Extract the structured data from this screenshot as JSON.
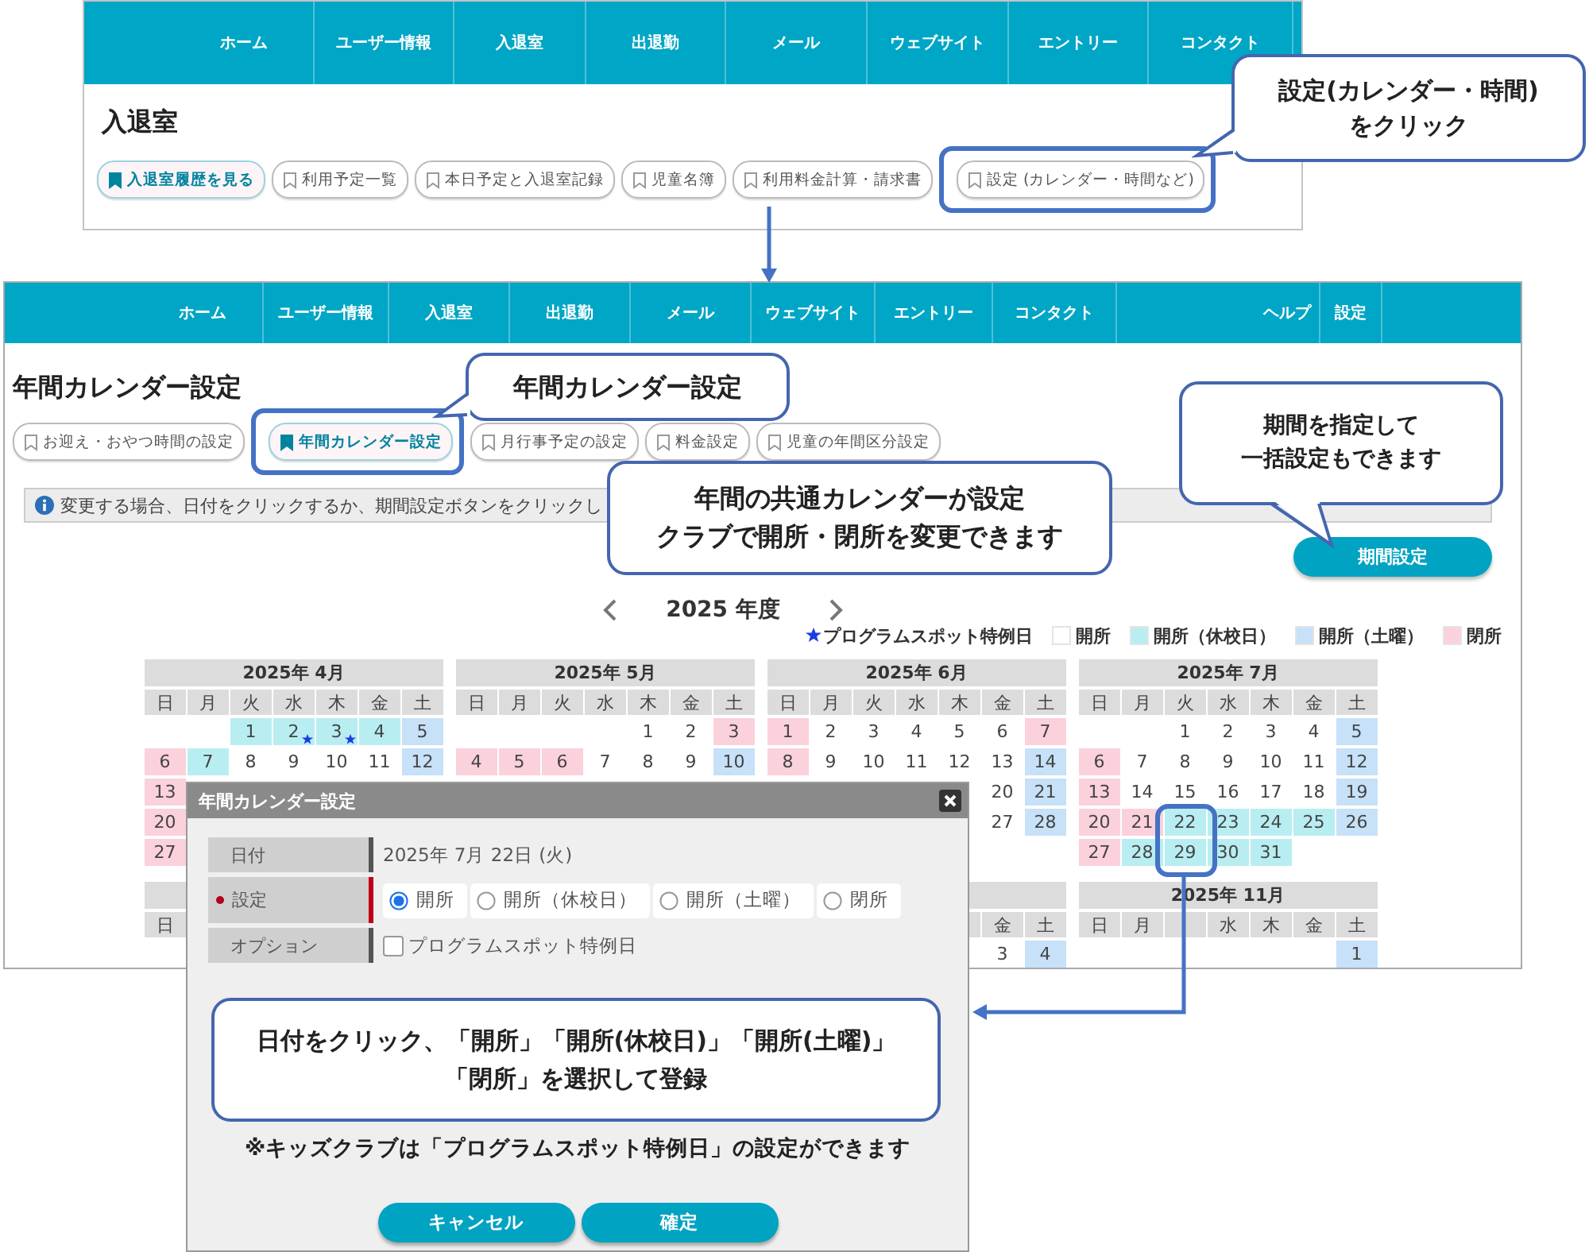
{
  "top_screen": {
    "nav": [
      "ホーム",
      "ユーザー情報",
      "入退室",
      "出退勤",
      "メール",
      "ウェブサイト",
      "エントリー",
      "コンタクト"
    ],
    "title": "入退室",
    "tabs": [
      {
        "label": "入退室履歴を見る",
        "selected": true
      },
      {
        "label": "利用予定一覧",
        "selected": false
      },
      {
        "label": "本日予定と入退室記録",
        "selected": false
      },
      {
        "label": "児童名簿",
        "selected": false
      },
      {
        "label": "利用料金計算・請求書",
        "selected": false
      },
      {
        "label": "設定 (カレンダー・時間など)",
        "selected": false
      }
    ]
  },
  "screen": {
    "nav": [
      "ホーム",
      "ユーザー情報",
      "入退室",
      "出退勤",
      "メール",
      "ウェブサイト",
      "エントリー",
      "コンタクト"
    ],
    "nav_right": [
      "ヘルプ",
      "設定"
    ],
    "title": "年間カレンダー設定",
    "tabs": [
      {
        "label": "お迎え・おやつ時間の設定",
        "selected": false
      },
      {
        "label": "年間カレンダー設定",
        "selected": true
      },
      {
        "label": "月行事予定の設定",
        "selected": false
      },
      {
        "label": "料金設定",
        "selected": false
      },
      {
        "label": "児童の年間区分設定",
        "selected": false
      }
    ],
    "info": "変更する場合、日付をクリックするか、期間設定ボタンをクリックし",
    "period_button": "期間設定",
    "year": "2025 年度",
    "legend": {
      "star_label": "プログラムスポット特例日",
      "items": [
        {
          "label": "開所",
          "color": "#ffffff"
        },
        {
          "label": "開所（休校日）",
          "color": "#b8eef1"
        },
        {
          "label": "開所（土曜）",
          "color": "#c6e1f8"
        },
        {
          "label": "閉所",
          "color": "#fbd1dc"
        }
      ]
    },
    "calendar": {
      "months": [
        {
          "kind": "month",
          "title": "2025年 4月",
          "weekdays": [
            {
              "kind": "label",
              "label": "日"
            },
            {
              "kind": "label",
              "label": "月"
            },
            {
              "kind": "label",
              "label": "火"
            },
            {
              "kind": "label",
              "label": "水"
            },
            {
              "kind": "label",
              "label": "木"
            },
            {
              "kind": "label",
              "label": "金"
            },
            {
              "kind": "label",
              "label": "土"
            }
          ],
          "weeks": [
            [
              {
                "kind": "blank"
              },
              {
                "kind": "blank"
              },
              {
                "kind": "date",
                "day": "1",
                "color": "#b8eef1",
                "star": false
              },
              {
                "kind": "date",
                "day": "2",
                "color": "#b8eef1",
                "star": true
              },
              {
                "kind": "date",
                "day": "3",
                "color": "#b8eef1",
                "star": true
              },
              {
                "kind": "date",
                "day": "4",
                "color": "#b8eef1",
                "star": false
              },
              {
                "kind": "date",
                "day": "5",
                "color": "#c6e1f8",
                "star": false
              }
            ],
            [
              {
                "kind": "date",
                "day": "6",
                "color": "#fbd1dc",
                "star": false
              },
              {
                "kind": "date",
                "day": "7",
                "color": "#b8eef1",
                "star": false
              },
              {
                "kind": "date",
                "day": "8",
                "color": "#ffffff",
                "star": false
              },
              {
                "kind": "date",
                "day": "9",
                "color": "#ffffff",
                "star": false
              },
              {
                "kind": "date",
                "day": "10",
                "color": "#ffffff",
                "star": false
              },
              {
                "kind": "date",
                "day": "11",
                "color": "#ffffff",
                "star": false
              },
              {
                "kind": "date",
                "day": "12",
                "color": "#c6e1f8",
                "star": false
              }
            ],
            [
              {
                "kind": "date",
                "day": "13",
                "color": "#fbd1dc",
                "star": false
              }
            ],
            [
              {
                "kind": "date",
                "day": "20",
                "color": "#fbd1dc",
                "star": false
              }
            ],
            [
              {
                "kind": "date",
                "day": "27",
                "color": "#fbd1dc",
                "star": false
              }
            ]
          ]
        },
        {
          "kind": "month",
          "title": "2025年 5月",
          "weekdays": [
            {
              "kind": "label",
              "label": "日"
            },
            {
              "kind": "label",
              "label": "月"
            },
            {
              "kind": "label",
              "label": "火"
            },
            {
              "kind": "label",
              "label": "水"
            },
            {
              "kind": "label",
              "label": "木"
            },
            {
              "kind": "label",
              "label": "金"
            },
            {
              "kind": "label",
              "label": "土"
            }
          ],
          "weeks": [
            [
              {
                "kind": "blank"
              },
              {
                "kind": "blank"
              },
              {
                "kind": "blank"
              },
              {
                "kind": "blank"
              },
              {
                "kind": "date",
                "day": "1",
                "color": "#ffffff",
                "star": false
              },
              {
                "kind": "date",
                "day": "2",
                "color": "#ffffff",
                "star": false
              },
              {
                "kind": "date",
                "day": "3",
                "color": "#fbd1dc",
                "star": false
              }
            ],
            [
              {
                "kind": "date",
                "day": "4",
                "color": "#fbd1dc",
                "star": false
              },
              {
                "kind": "date",
                "day": "5",
                "color": "#fbd1dc",
                "star": false
              },
              {
                "kind": "date",
                "day": "6",
                "color": "#fbd1dc",
                "star": false
              },
              {
                "kind": "date",
                "day": "7",
                "color": "#ffffff",
                "star": false
              },
              {
                "kind": "date",
                "day": "8",
                "color": "#ffffff",
                "star": false
              },
              {
                "kind": "date",
                "day": "9",
                "color": "#ffffff",
                "star": false
              },
              {
                "kind": "date",
                "day": "10",
                "color": "#c6e1f8",
                "star": false
              }
            ]
          ]
        },
        {
          "kind": "month",
          "title": "2025年 6月",
          "weekdays": [
            {
              "kind": "label",
              "label": "日"
            },
            {
              "kind": "label",
              "label": "月"
            },
            {
              "kind": "label",
              "label": "火"
            },
            {
              "kind": "label",
              "label": "水"
            },
            {
              "kind": "label",
              "label": "木"
            },
            {
              "kind": "label",
              "label": "金"
            },
            {
              "kind": "label",
              "label": "土"
            }
          ],
          "weeks": [
            [
              {
                "kind": "date",
                "day": "1",
                "color": "#fbd1dc",
                "star": false
              },
              {
                "kind": "date",
                "day": "2",
                "color": "#ffffff",
                "star": false
              },
              {
                "kind": "date",
                "day": "3",
                "color": "#ffffff",
                "star": false
              },
              {
                "kind": "date",
                "day": "4",
                "color": "#ffffff",
                "star": false
              },
              {
                "kind": "date",
                "day": "5",
                "color": "#ffffff",
                "star": false
              },
              {
                "kind": "date",
                "day": "6",
                "color": "#ffffff",
                "star": false
              },
              {
                "kind": "date",
                "day": "7",
                "color": "#fbd1dc",
                "star": false
              }
            ],
            [
              {
                "kind": "date",
                "day": "8",
                "color": "#fbd1dc",
                "star": false
              },
              {
                "kind": "date",
                "day": "9",
                "color": "#ffffff",
                "star": false
              },
              {
                "kind": "date",
                "day": "10",
                "color": "#ffffff",
                "star": false
              },
              {
                "kind": "date",
                "day": "11",
                "color": "#ffffff",
                "star": false
              },
              {
                "kind": "date",
                "day": "12",
                "color": "#ffffff",
                "star": false
              },
              {
                "kind": "date",
                "day": "13",
                "color": "#ffffff",
                "star": false
              },
              {
                "kind": "date",
                "day": "14",
                "color": "#c6e1f8",
                "star": false
              }
            ],
            [
              {
                "kind": "blank"
              },
              {
                "kind": "blank"
              },
              {
                "kind": "blank"
              },
              {
                "kind": "blank"
              },
              {
                "kind": "blank"
              },
              {
                "kind": "date",
                "day": "20",
                "color": "#ffffff",
                "star": false
              },
              {
                "kind": "date",
                "day": "21",
                "color": "#c6e1f8",
                "star": false
              }
            ],
            [
              {
                "kind": "blank"
              },
              {
                "kind": "blank"
              },
              {
                "kind": "blank"
              },
              {
                "kind": "blank"
              },
              {
                "kind": "blank"
              },
              {
                "kind": "date",
                "day": "27",
                "color": "#ffffff",
                "star": false
              },
              {
                "kind": "date",
                "day": "28",
                "color": "#c6e1f8",
                "star": false
              }
            ]
          ]
        },
        {
          "kind": "month",
          "title": "2025年 7月",
          "weekdays": [
            {
              "kind": "label",
              "label": "日"
            },
            {
              "kind": "label",
              "label": "月"
            },
            {
              "kind": "label",
              "label": "火"
            },
            {
              "kind": "label",
              "label": "水"
            },
            {
              "kind": "label",
              "label": "木"
            },
            {
              "kind": "label",
              "label": "金"
            },
            {
              "kind": "label",
              "label": "土"
            }
          ],
          "weeks": [
            [
              {
                "kind": "blank"
              },
              {
                "kind": "blank"
              },
              {
                "kind": "date",
                "day": "1",
                "color": "#ffffff",
                "star": false
              },
              {
                "kind": "date",
                "day": "2",
                "color": "#ffffff",
                "star": false
              },
              {
                "kind": "date",
                "day": "3",
                "color": "#ffffff",
                "star": false
              },
              {
                "kind": "date",
                "day": "4",
                "color": "#ffffff",
                "star": false
              },
              {
                "kind": "date",
                "day": "5",
                "color": "#c6e1f8",
                "star": false
              }
            ],
            [
              {
                "kind": "date",
                "day": "6",
                "color": "#fbd1dc",
                "star": false
              },
              {
                "kind": "date",
                "day": "7",
                "color": "#ffffff",
                "star": false
              },
              {
                "kind": "date",
                "day": "8",
                "color": "#ffffff",
                "star": false
              },
              {
                "kind": "date",
                "day": "9",
                "color": "#ffffff",
                "star": false
              },
              {
                "kind": "date",
                "day": "10",
                "color": "#ffffff",
                "star": false
              },
              {
                "kind": "date",
                "day": "11",
                "color": "#ffffff",
                "star": false
              },
              {
                "kind": "date",
                "day": "12",
                "color": "#c6e1f8",
                "star": false
              }
            ],
            [
              {
                "kind": "date",
                "day": "13",
                "color": "#fbd1dc",
                "star": false
              },
              {
                "kind": "date",
                "day": "14",
                "color": "#ffffff",
                "star": false
              },
              {
                "kind": "date",
                "day": "15",
                "color": "#ffffff",
                "star": false
              },
              {
                "kind": "date",
                "day": "16",
                "color": "#ffffff",
                "star": false
              },
              {
                "kind": "date",
                "day": "17",
                "color": "#ffffff",
                "star": false
              },
              {
                "kind": "date",
                "day": "18",
                "color": "#ffffff",
                "star": false
              },
              {
                "kind": "date",
                "day": "19",
                "color": "#c6e1f8",
                "star": false
              }
            ],
            [
              {
                "kind": "date",
                "day": "20",
                "color": "#fbd1dc",
                "star": false
              },
              {
                "kind": "date",
                "day": "21",
                "color": "#fbd1dc",
                "star": false
              },
              {
                "kind": "date",
                "day": "22",
                "color": "#b8eef1",
                "star": false
              },
              {
                "kind": "date",
                "day": "23",
                "color": "#b8eef1",
                "star": false
              },
              {
                "kind": "date",
                "day": "24",
                "color": "#b8eef1",
                "star": false
              },
              {
                "kind": "date",
                "day": "25",
                "color": "#b8eef1",
                "star": false
              },
              {
                "kind": "date",
                "day": "26",
                "color": "#c6e1f8",
                "star": false
              }
            ],
            [
              {
                "kind": "date",
                "day": "27",
                "color": "#fbd1dc",
                "star": false
              },
              {
                "kind": "date",
                "day": "28",
                "color": "#b8eef1",
                "star": false
              },
              {
                "kind": "date",
                "day": "29",
                "color": "#b8eef1",
                "star": false
              },
              {
                "kind": "date",
                "day": "30",
                "color": "#b8eef1",
                "star": false
              },
              {
                "kind": "date",
                "day": "31",
                "color": "#b8eef1",
                "star": false
              }
            ]
          ]
        },
        {
          "kind": "month",
          "weekdays": [
            {
              "kind": "label",
              "label": "日"
            }
          ]
        },
        {
          "kind": "covered"
        },
        {
          "kind": "month",
          "weekdays": [
            {
              "kind": "blank"
            },
            {
              "kind": "blank"
            },
            {
              "kind": "blank"
            },
            {
              "kind": "blank"
            },
            {
              "kind": "empty"
            },
            {
              "kind": "label",
              "label": "金"
            },
            {
              "kind": "label",
              "label": "土"
            }
          ],
          "weeks": [
            [
              {
                "kind": "blank"
              },
              {
                "kind": "blank"
              },
              {
                "kind": "blank"
              },
              {
                "kind": "blank"
              },
              {
                "kind": "blank"
              },
              {
                "kind": "date",
                "day": "3",
                "color": "#ffffff",
                "star": false
              },
              {
                "kind": "date",
                "day": "4",
                "color": "#c6e1f8",
                "star": false
              }
            ]
          ]
        },
        {
          "kind": "month",
          "title": "2025年 11月",
          "weekdays": [
            {
              "kind": "label",
              "label": "日"
            },
            {
              "kind": "label",
              "label": "月"
            },
            {
              "kind": "empty"
            },
            {
              "kind": "label",
              "label": "水"
            },
            {
              "kind": "label",
              "label": "木"
            },
            {
              "kind": "label",
              "label": "金"
            },
            {
              "kind": "label",
              "label": "土"
            }
          ],
          "weeks": [
            [
              {
                "kind": "blank"
              },
              {
                "kind": "blank"
              },
              {
                "kind": "blank"
              },
              {
                "kind": "blank"
              },
              {
                "kind": "blank"
              },
              {
                "kind": "blank"
              },
              {
                "kind": "date",
                "day": "1",
                "color": "#c6e1f8",
                "star": false
              }
            ]
          ]
        }
      ]
    }
  },
  "dialog": {
    "title": "年間カレンダー設定",
    "fields": [
      {
        "label": "日付",
        "kind": "text",
        "required": false,
        "value": "2025年 7月 22日 (火)"
      },
      {
        "label": "設定",
        "kind": "radio",
        "required": true,
        "options": [
          {
            "label": "開所",
            "selected": true
          },
          {
            "label": "開所（休校日）",
            "selected": false
          },
          {
            "label": "開所（土曜）",
            "selected": false
          },
          {
            "label": "閉所",
            "selected": false
          }
        ]
      },
      {
        "label": "オプション",
        "kind": "checkbox",
        "required": false,
        "option": "プログラムスポット特例日",
        "checked": false
      }
    ],
    "callout": [
      "日付をクリック、「開所」「開所(休校日)」「開所(土曜)」",
      "「閉所」を選択して登録"
    ],
    "note": "※キッズクラブは「プログラムスポット特例日」の設定ができます",
    "buttons": [
      "キャンセル",
      "確定"
    ]
  },
  "callouts": [
    [
      "設定(カレンダー・時間)",
      "をクリック"
    ],
    [
      "年間カレンダー設定"
    ],
    [
      "期間を指定して",
      "一括設定もできます"
    ],
    [
      "年間の共通カレンダーが設定",
      "クラブで開所・閉所を変更できます"
    ]
  ]
}
